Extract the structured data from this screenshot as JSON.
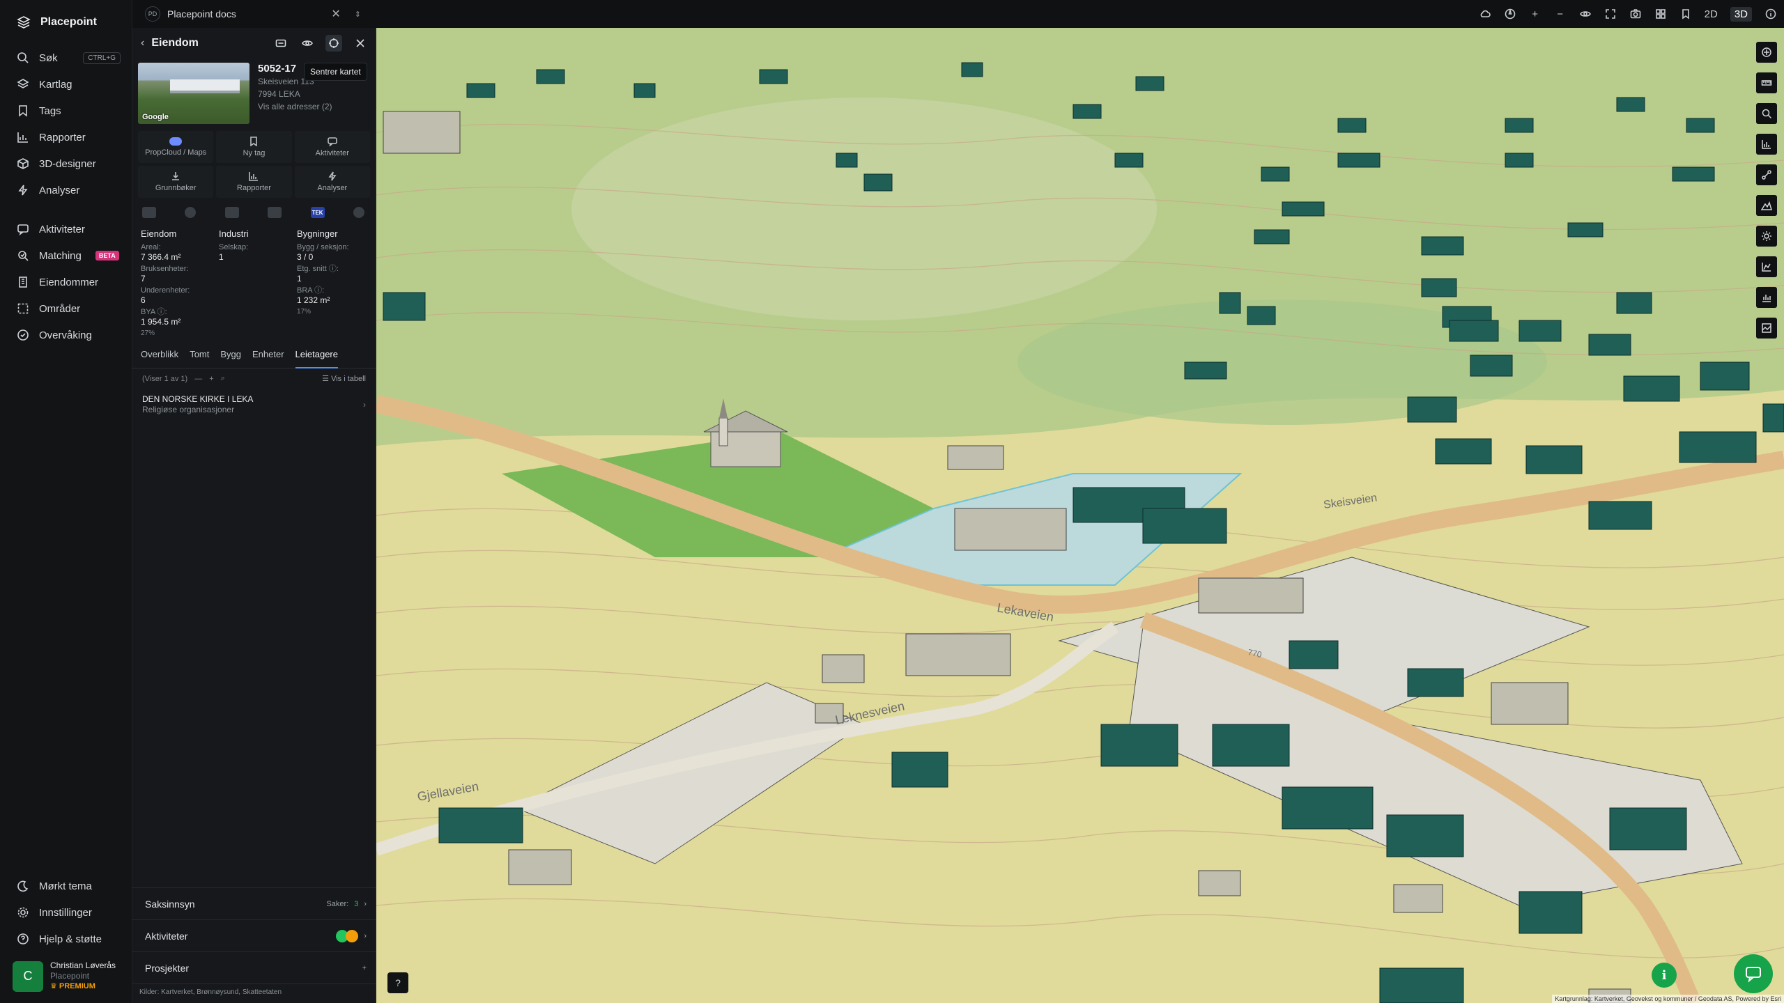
{
  "app": {
    "brand": "Placepoint"
  },
  "nav": {
    "items": [
      {
        "label": "Søk",
        "kbd": "CTRL+G",
        "icon": "search-icon"
      },
      {
        "label": "Kartlag",
        "icon": "layers-icon"
      },
      {
        "label": "Tags",
        "icon": "bookmark-icon"
      },
      {
        "label": "Rapporter",
        "icon": "chart-icon"
      },
      {
        "label": "3D-designer",
        "icon": "cube-icon"
      },
      {
        "label": "Analyser",
        "icon": "bolt-icon"
      }
    ],
    "items2": [
      {
        "label": "Aktiviteter",
        "icon": "activity-icon"
      },
      {
        "label": "Matching",
        "badge": "BETA",
        "icon": "match-icon"
      },
      {
        "label": "Eiendommer",
        "icon": "building-icon"
      },
      {
        "label": "Områder",
        "icon": "area-icon"
      },
      {
        "label": "Overvåking",
        "icon": "monitor-icon"
      }
    ],
    "bottom": [
      {
        "label": "Mørkt tema",
        "icon": "moon-icon"
      },
      {
        "label": "Innstillinger",
        "icon": "gear-icon"
      },
      {
        "label": "Hjelp & støtte",
        "icon": "help-icon"
      }
    ],
    "user": {
      "initial": "C",
      "name": "Christian Løverås",
      "org": "Placepoint",
      "plan": "PREMIUM"
    }
  },
  "topbar": {
    "doc_badge": "PD",
    "doc_title": "Placepoint docs",
    "mode_2d": "2D",
    "mode_3d": "3D"
  },
  "panel": {
    "title": "Eiendom",
    "tooltip": "Sentrer kartet",
    "matrikkel": "5052-17",
    "address": "Skeisveien 113",
    "postal": "7994 LEKA",
    "all_addresses": "Vis alle adresser (2)",
    "thumb_label": "Google",
    "actions": [
      {
        "label": "PropCloud / Maps",
        "icon": "cloud-icon"
      },
      {
        "label": "Ny tag",
        "icon": "bookmark-icon"
      },
      {
        "label": "Aktiviteter",
        "icon": "chat-icon"
      },
      {
        "label": "Grunnbøker",
        "icon": "download-icon"
      },
      {
        "label": "Rapporter",
        "icon": "chart-icon"
      },
      {
        "label": "Analyser",
        "icon": "bolt-icon"
      }
    ],
    "sector_tek": "TEK",
    "stats": {
      "col1": {
        "head": "Eiendom",
        "rows": [
          {
            "label": "Areal:",
            "value": "7 366.4 m²"
          },
          {
            "label": "Bruksenheter:",
            "value": "7"
          },
          {
            "label": "Underenheter:",
            "value": "6"
          },
          {
            "label": "BYA ⓘ:",
            "value": "1 954.5 m²",
            "pct": "27%"
          }
        ]
      },
      "col2": {
        "head": "Industri",
        "rows": [
          {
            "label": "Selskap:",
            "value": "1"
          }
        ]
      },
      "col3": {
        "head": "Bygninger",
        "rows": [
          {
            "label": "Bygg / seksjon:",
            "value": "3 / 0"
          },
          {
            "label": "Etg. snitt ⓘ:",
            "value": "1"
          },
          {
            "label": "BRA ⓘ:",
            "value": "1 232 m²",
            "pct": "17%"
          }
        ]
      }
    },
    "tabs": [
      "Overblikk",
      "Tomt",
      "Bygg",
      "Enheter",
      "Leietagere"
    ],
    "list_count": "(Viser 1 av 1)",
    "list_table": "Vis i tabell",
    "tenant": {
      "name": "DEN NORSKE KIRKE I LEKA",
      "sub": "Religiøse organisasjoner"
    },
    "footer": {
      "saksinnsyn": "Saksinnsyn",
      "saker_label": "Saker:",
      "saker_count": "3",
      "aktiviteter": "Aktiviteter",
      "prosjekter": "Prosjekter",
      "sources_label": "Kilder:",
      "sources": [
        "Kartverket,",
        "Brønnøysund,",
        "Skatteetaten"
      ]
    }
  },
  "map": {
    "road_label_1": "Lekaveien",
    "road_label_2": "Leknesveien",
    "road_label_3": "Skeisveien",
    "road_label_4": "Gjellaveien",
    "road_num": "770",
    "attribution": "Kartgrunnlag: Kartverket, Geovekst og kommuner / Geodata AS, Powered by Esri"
  },
  "colors": {
    "accent": "#4f8ef7",
    "green_button": "#16a34a",
    "building_teal": "#1f5f56",
    "plot_green": "#7bb858",
    "plot_blue": "#bcd9dc"
  }
}
